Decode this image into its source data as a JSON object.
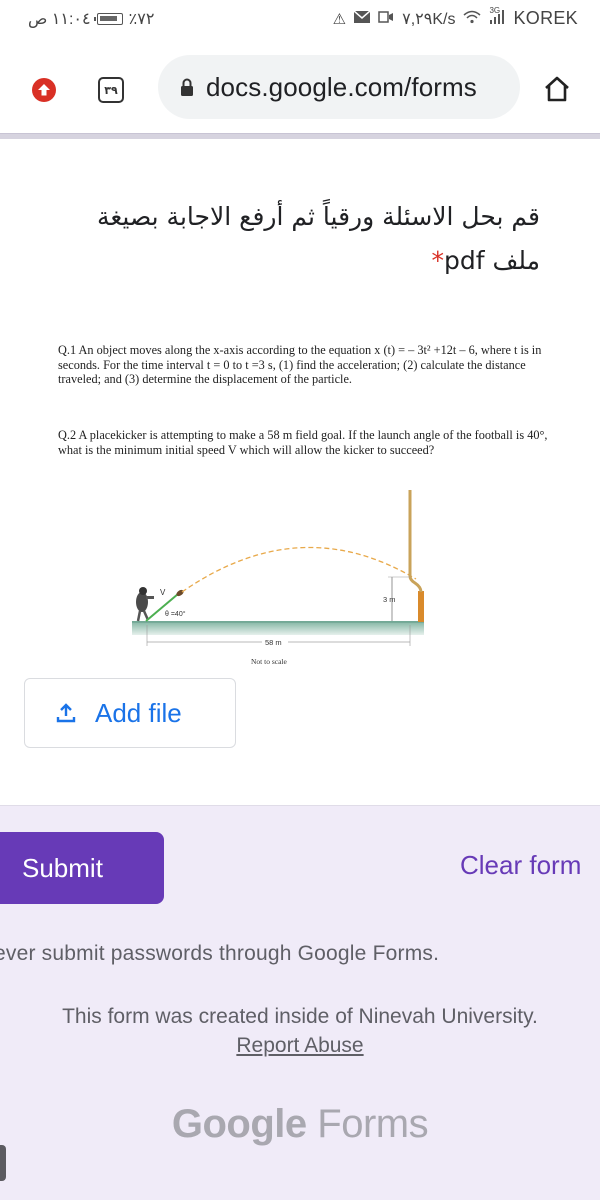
{
  "status_bar": {
    "time": "١١:٠٤ ص",
    "battery": "٪٧٢",
    "network_speed": "٧,٢٩K/s",
    "network_type": "3G",
    "carrier": "KOREK",
    "icons": [
      "warning-icon",
      "mail-icon",
      "video-icon",
      "wifi-icon",
      "signal-icon",
      "battery-icon"
    ]
  },
  "browser": {
    "tab_count": "٣٩",
    "url": "docs.google.com/forms",
    "icons": [
      "update-icon",
      "tabs-icon",
      "lock-icon",
      "home-icon"
    ]
  },
  "question": {
    "title_line1": "قم بحل الاسئلة ورقياً ثم أرفع الاجابة بصيغة",
    "title_line2": "ملف pdf",
    "required_marker": "*",
    "q1": "Q.1 An object moves along the x-axis according to the equation x (t) = – 3t² +12t – 6, where t is in seconds. For the time interval t = 0  to  t =3 s, (1) find the acceleration; (2) calculate the distance traveled; and (3) determine the displacement of the particle.",
    "q2": "Q.2 A placekicker is attempting to make a 58 m field goal. If the launch angle of the football is 40°, what is the minimum initial speed V which will allow the kicker to succeed?",
    "diagram": {
      "velocity_label": "V",
      "angle_label": "θ =40°",
      "height_label": "3 m",
      "distance_label": "58 m",
      "note": "Not to scale"
    }
  },
  "add_file": {
    "label": "Add file",
    "icon": "upload-icon"
  },
  "footer": {
    "submit_label": "Submit",
    "clear_label": "Clear form",
    "warning": "ever submit passwords through Google Forms.",
    "created_text": "This form was created inside of Ninevah University.",
    "report_link": "Report Abuse",
    "logo_google": "Google",
    "logo_forms": "Forms"
  },
  "colors": {
    "accent": "#673ab7",
    "link_blue": "#1a73e8",
    "required_red": "#d93025",
    "footer_bg": "#f0ebf8"
  }
}
